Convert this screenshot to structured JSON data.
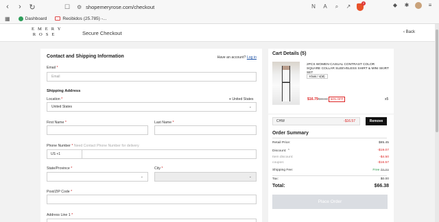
{
  "browser": {
    "url": "shopemeryrose.com/checkout",
    "nav": {
      "back": "‹",
      "forward": "›",
      "reload": "↻"
    },
    "bookmarks": [
      {
        "label": "Dashboard",
        "icon": "dashboard-icon"
      },
      {
        "label": "Recibidos (25.785) -...",
        "icon": "gmail-icon"
      }
    ],
    "shield_badge": "2"
  },
  "header": {
    "logo_top": "EMERY",
    "logo_bottom": "ROSE",
    "title": "Secure Checkout",
    "back": "Back"
  },
  "form": {
    "title": "Contact and Shipping Information",
    "account_prompt": "Have an account?",
    "login": "Log in",
    "email_label": "Email",
    "email_placeholder": "Email",
    "shipping_title": "Shipping Address",
    "location_label": "Location",
    "location_right": "United States",
    "location_value": "United States",
    "first_name_label": "First Name",
    "last_name_label": "Last Name",
    "phone_label": "Phone Number",
    "phone_hint": "Need Contact Phone Number for delivery",
    "phone_prefix": "US +1",
    "state_label": "State/Province",
    "city_label": "City",
    "zip_label": "Post/ZIP Code",
    "address_label": "Address Line 1"
  },
  "cart": {
    "title": "Cart Details (5)",
    "product_name": "2PCS WOMEN CASUAL CONTRAST COLOR SQUARE COLLAR SLEEVELESS SHIRT & MINI SKIRT SET",
    "variant": "Khaki / 4(M)",
    "sale_price": "$16.79",
    "orig_price": "$33.58",
    "discount_badge": "50% OFF",
    "qty": "x5"
  },
  "summary": {
    "coupon_code": "CHW",
    "coupon_amount": "-$16.57",
    "remove": "Remove",
    "title": "Order Summary",
    "retail_label": "Retail Price:",
    "retail_value": "$85.45",
    "discount_label": "Discount:",
    "discount_value": "-$19.07",
    "item_discount_label": "Item discount:",
    "item_discount_value": "-$4.50",
    "coupon_label": "coupon:",
    "coupon_value": "-$16.57",
    "shipping_label": "Shipping Fee:",
    "shipping_free": "Free",
    "shipping_value": "$9.99",
    "tax_label": "Tax:",
    "tax_value": "$0.00",
    "total_label": "Total:",
    "total_value": "$66.38",
    "place_order": "Place Order"
  }
}
